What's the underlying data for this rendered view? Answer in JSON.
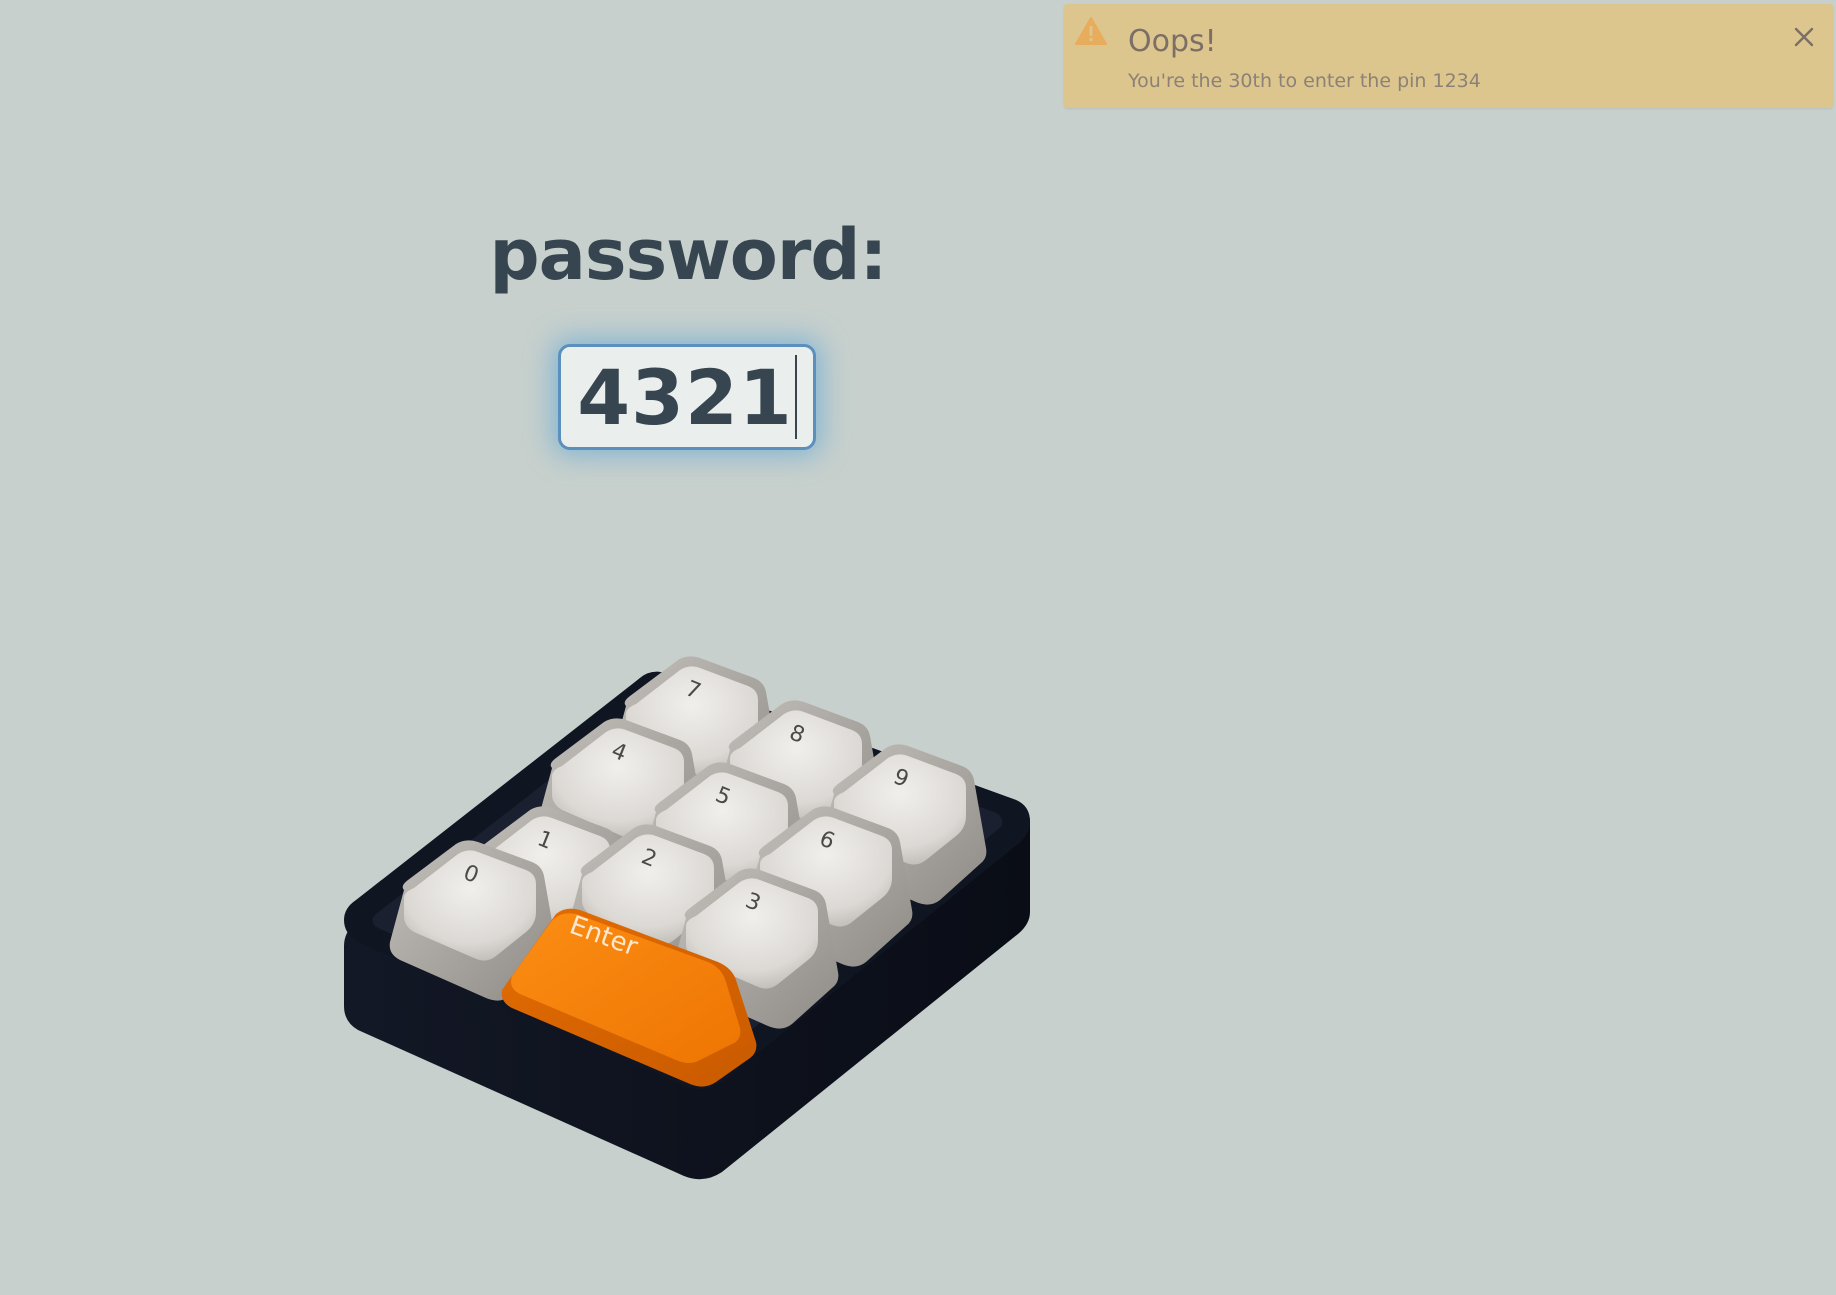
{
  "toast": {
    "title": "Oops!",
    "message": "You're the 30th to enter the pin 1234",
    "icon": "warning-icon",
    "close_icon": "close-icon"
  },
  "password": {
    "label": "password:",
    "value": "4321"
  },
  "keypad": {
    "keys": {
      "k7": "7",
      "k8": "8",
      "k9": "9",
      "k4": "4",
      "k5": "5",
      "k6": "6",
      "k1": "1",
      "k2": "2",
      "k3": "3",
      "k0": "0"
    },
    "enter_label": "Enter"
  },
  "colors": {
    "background": "#c7d0cd",
    "toast_background": "#dcc68e",
    "key_base": "#d9d6d3",
    "enter_key": "#f57d02",
    "case": "#0e121c",
    "field_border": "#5b8fbd"
  }
}
